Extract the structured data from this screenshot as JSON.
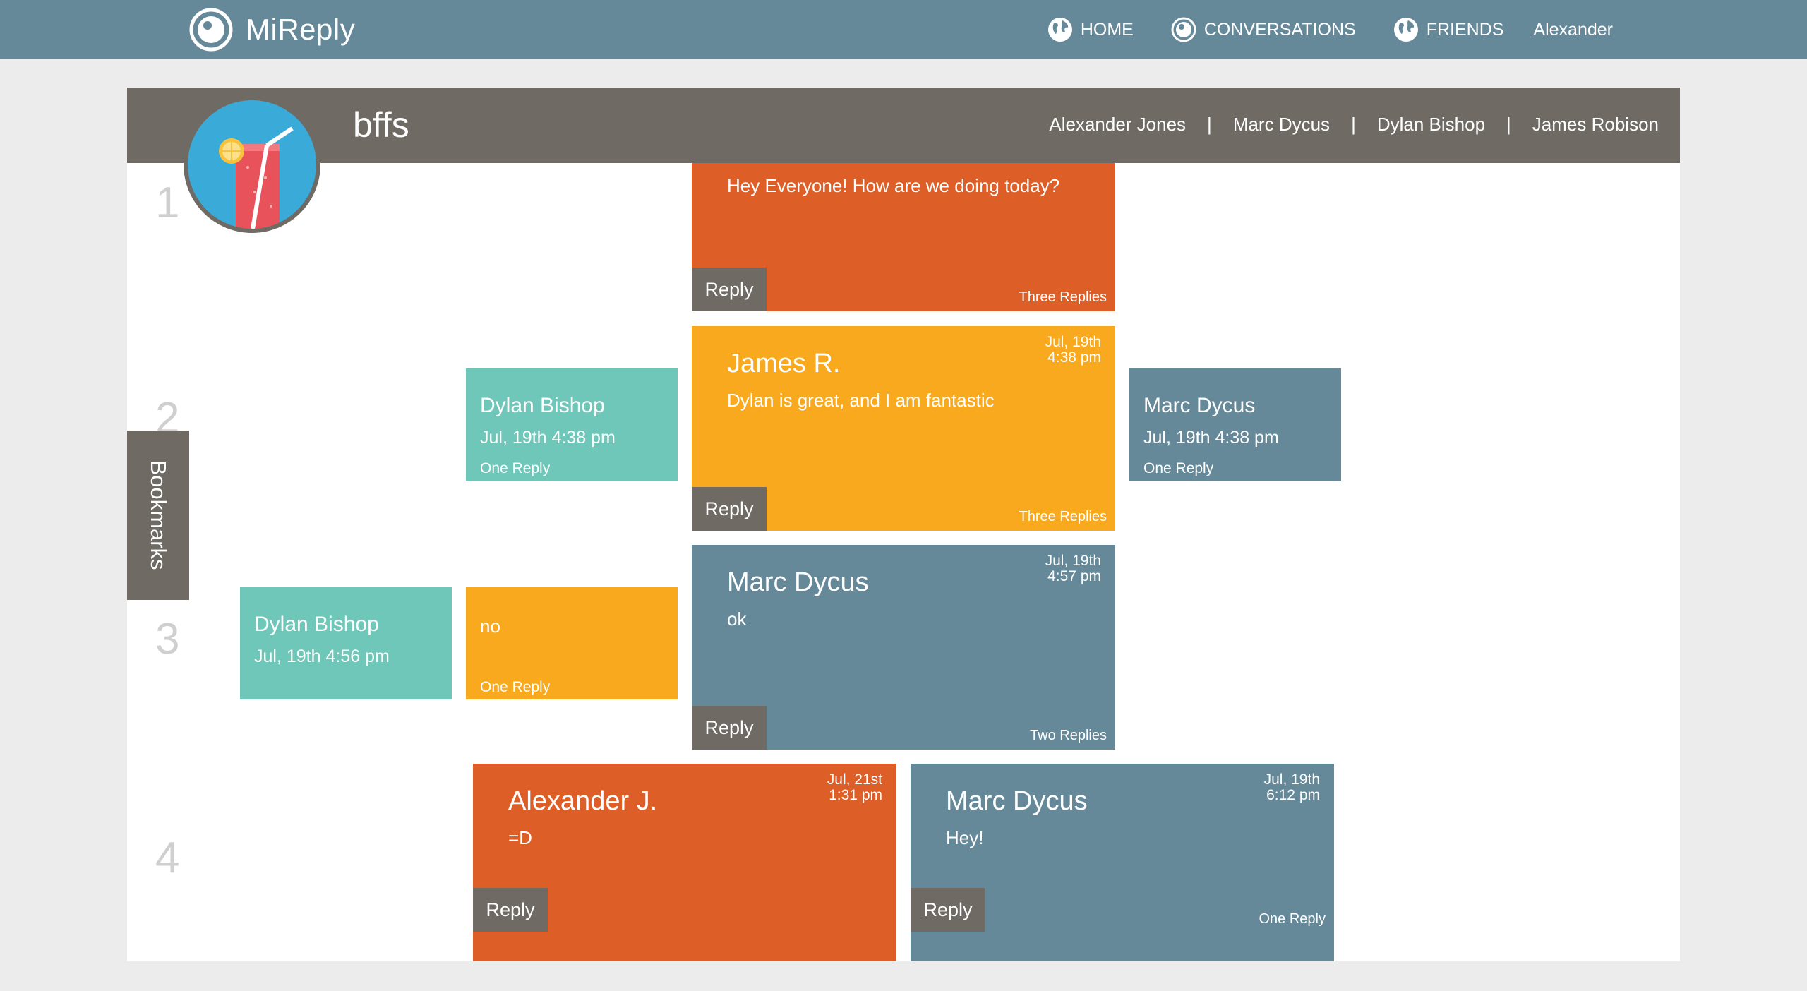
{
  "app": {
    "brand": "MiReply",
    "nav": [
      {
        "label": "HOME",
        "icon": "globe-icon"
      },
      {
        "label": "CONVERSATIONS",
        "icon": "eye-icon"
      },
      {
        "label": "FRIENDS",
        "icon": "globe-icon"
      }
    ],
    "user": "Alexander"
  },
  "conversation": {
    "title": "bffs",
    "members": [
      "Alexander Jones",
      "Marc Dycus",
      "Dylan Bishop",
      "James Robison"
    ],
    "separator": "|",
    "bookmarks_label": "Bookmarks",
    "row_numbers": [
      "1",
      "2",
      "3",
      "4"
    ]
  },
  "messages": {
    "root": {
      "text": "Hey Everyone! How are we doing today?",
      "replies": "Three Replies",
      "reply_label": "Reply"
    },
    "r2_main": {
      "author": "James R.",
      "text": "Dylan is great, and I am fantastic",
      "date_line1": "Jul, 19th",
      "date_line2": "4:38 pm",
      "replies": "Three Replies",
      "reply_label": "Reply"
    },
    "r2_left": {
      "author": "Dylan Bishop",
      "date": "Jul, 19th 4:38 pm",
      "replies": "One Reply"
    },
    "r2_right": {
      "author": "Marc Dycus",
      "date": "Jul, 19th 4:38 pm",
      "replies": "One Reply"
    },
    "r3_main": {
      "author": "Marc Dycus",
      "text": "ok",
      "date_line1": "Jul, 19th",
      "date_line2": "4:57 pm",
      "replies": "Two Replies",
      "reply_label": "Reply"
    },
    "r3_left_outer": {
      "author": "Dylan Bishop",
      "date": "Jul, 19th 4:56 pm"
    },
    "r3_left_inner": {
      "text": "no",
      "replies": "One Reply"
    },
    "r4_left": {
      "author": "Alexander J.",
      "text": "=D",
      "date_line1": "Jul, 21st",
      "date_line2": "1:31 pm",
      "reply_label": "Reply"
    },
    "r4_right": {
      "author": "Marc Dycus",
      "text": "Hey!",
      "date_line1": "Jul, 19th",
      "date_line2": "6:12 pm",
      "replies": "One Reply",
      "reply_label": "Reply"
    }
  },
  "colors": {
    "navbar": "#66899a",
    "header": "#6f6a64",
    "orange": "#de5e27",
    "yellow": "#f9a91d",
    "teal": "#6fc7b9",
    "slate": "#66899a",
    "avatar_bg": "#3aabd8"
  }
}
